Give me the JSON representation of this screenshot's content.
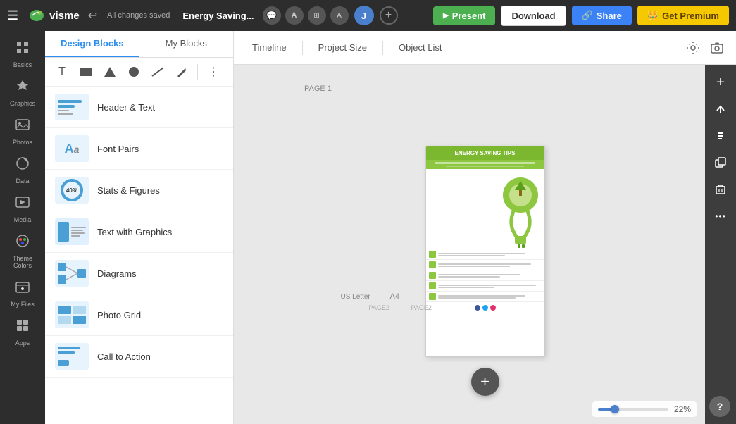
{
  "topbar": {
    "menu_icon": "☰",
    "logo_text": "visme",
    "undo_icon": "↩",
    "saved_text": "All changes saved",
    "title": "Energy Saving...",
    "comment_icon": "💬",
    "font_icon": "A",
    "present_label": "Present",
    "download_label": "Download",
    "share_label": "Share",
    "premium_label": "Get Premium",
    "avatar_letter": "J"
  },
  "icon_sidebar": {
    "items": [
      {
        "id": "basics",
        "icon": "⊞",
        "label": "Basics"
      },
      {
        "id": "graphics",
        "icon": "★",
        "label": "Graphics"
      },
      {
        "id": "photos",
        "icon": "🖼",
        "label": "Photos"
      },
      {
        "id": "data",
        "icon": "◔",
        "label": "Data"
      },
      {
        "id": "media",
        "icon": "▶",
        "label": "Media"
      },
      {
        "id": "theme-colors",
        "icon": "🎨",
        "label": "Theme Colors"
      },
      {
        "id": "my-files",
        "icon": "📁",
        "label": "My Files"
      },
      {
        "id": "apps",
        "icon": "⊞",
        "label": "Apps"
      }
    ]
  },
  "design_panel": {
    "tab_design": "Design Blocks",
    "tab_my": "My Blocks",
    "blocks": [
      {
        "id": "header-text",
        "label": "Header & Text",
        "type": "header"
      },
      {
        "id": "font-pairs",
        "label": "Font Pairs",
        "type": "font"
      },
      {
        "id": "stats-figures",
        "label": "Stats & Figures",
        "type": "stats"
      },
      {
        "id": "text-with-graphics",
        "label": "Text with Graphics",
        "type": "twg"
      },
      {
        "id": "diagrams",
        "label": "Diagrams",
        "type": "diag"
      },
      {
        "id": "photo-grid",
        "label": "Photo Grid",
        "type": "grid"
      },
      {
        "id": "call-to-action",
        "label": "Call to Action",
        "type": "cta"
      }
    ]
  },
  "canvas": {
    "tabs": [
      {
        "id": "timeline",
        "label": "Timeline"
      },
      {
        "id": "project-size",
        "label": "Project Size"
      },
      {
        "id": "object-list",
        "label": "Object List"
      }
    ],
    "page1_label": "PAGE 1",
    "page2_us_label": "US Letter",
    "page2_label": "PAGE2",
    "page2_a4_label": "A4",
    "page2_a4_sub": "PAGE2",
    "infographic_title": "ENERGY SAVING TIPS",
    "zoom_value": "22%",
    "add_page_icon": "+",
    "help_icon": "?"
  },
  "right_panel": {
    "buttons": [
      {
        "id": "add",
        "icon": "+"
      },
      {
        "id": "move-up",
        "icon": "↑"
      },
      {
        "id": "move-down",
        "icon": "↓"
      },
      {
        "id": "duplicate",
        "icon": "⧉"
      },
      {
        "id": "delete",
        "icon": "🗑"
      },
      {
        "id": "more",
        "icon": "•••"
      }
    ]
  }
}
